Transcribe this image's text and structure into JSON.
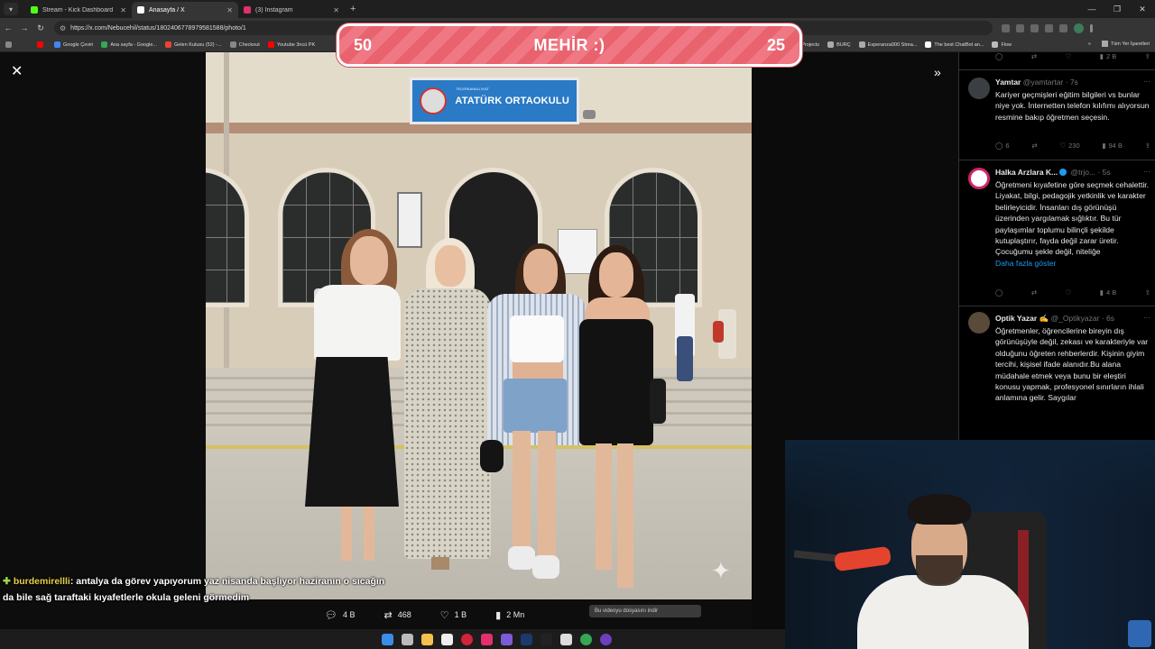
{
  "browser": {
    "tabs": [
      {
        "label": "Stream - Kick Dashboard",
        "active": false,
        "favicon_color": "#53fc18"
      },
      {
        "label": "Anasayfa / X",
        "active": true,
        "favicon_color": "#ffffff"
      },
      {
        "label": "(3) Instagram",
        "active": false,
        "favicon_color": "#e1306c"
      }
    ],
    "url": "https://x.com/Nebucehil/status/1802406778979581588/photo/1",
    "bookmarks": [
      {
        "label": "Google Çeviri",
        "color": "#4285f4"
      },
      {
        "label": "Ana sayfa - Google...",
        "color": "#34a853"
      },
      {
        "label": "Gelen Kutusu (52) -...",
        "color": "#ea4335"
      },
      {
        "label": "Checkout",
        "color": "#888888"
      },
      {
        "label": "Youtube 3ncü PK",
        "color": "#ff0000"
      },
      {
        "label": "yGen - Projects",
        "color": "#777777"
      },
      {
        "label": "BURÇ",
        "color": "#aaaaaa"
      },
      {
        "label": "Esperanza000 Strea...",
        "color": "#777777"
      },
      {
        "label": "The best ChatBot an...",
        "color": "#ffffff"
      },
      {
        "label": "Flow",
        "color": "#bbbbbb"
      }
    ],
    "bookmarks_all": "Tüm Yer İşaretleri"
  },
  "banner": {
    "left_number": "50",
    "title": "MEHİR :)",
    "right_number": "25"
  },
  "photo": {
    "sign_small": "TELERKANALI İKAT",
    "sign_name": "ATATÜRK ORTAOKULU"
  },
  "post_actions": {
    "replies": "4 B",
    "reposts": "468",
    "likes": "1 B",
    "views": "2 Mn",
    "download_hint": "Bu videoyu dosyasını indir"
  },
  "chat": {
    "username": "burdemirellli",
    "message": ": antalya da görev yapıyorum yaz nisanda başlıyor haziranın o sıcağın da bile sağ taraftaki kıyafetlerle okula geleni görmedim"
  },
  "tweets": [
    {
      "name": "",
      "handle": "",
      "time": "",
      "text": "",
      "replies": "",
      "reposts": "",
      "likes": "",
      "views": "2 B",
      "avatar_color": "#000000"
    },
    {
      "name": "Yamtar",
      "handle": "@yamtartar",
      "time": "· 7s",
      "text": "Kariyer geçmişleri eğitim bilgileri vs bunlar niye yok. İnternetten telefon kılıfımı alıyorsun resmine bakıp öğretmen seçesin.",
      "replies": "6",
      "reposts": "",
      "likes": "230",
      "views": "94 B",
      "avatar_color": "#3b3f44"
    },
    {
      "name": "Halka Arzlara K...",
      "handle": "@trjo...",
      "time": "· 5s",
      "text": "Öğretmeni kıyafetine göre seçmek cehalettir. Liyakat, bilgi, pedagojik yetkinlik ve karakter belirleyicidir. İnsanları dış görünüşü üzerinden yargılamak sığlıktır. Bu tür paylaşımlar toplumu bilinçli şekilde kutuplaştırır, fayda değil zarar üretir. Çocuğumu şekle değil, niteliğe",
      "show_more": "Daha fazla göster",
      "replies": "",
      "reposts": "",
      "likes": "",
      "views": "4 B",
      "avatar_color": "#d0246b"
    },
    {
      "name": "Optik Yazar ✍",
      "handle": "@_Optikyazar",
      "time": "· 6s",
      "text": "Öğretmenler, öğrencilerine bireyin dış görünüşüyle değil, zekası ve karakteriyle var olduğunu öğreten rehberlerdir. Kişinin giyim tercihi, kişisel ifade alanıdır.Bu alana müdahale etmek veya bunu bir eleştiri konusu yapmak, profesyonel sınırların ihlali anlamına gelir. Saygılar",
      "avatar_color": "#5a4a3a"
    }
  ],
  "icons": {
    "close": "close-icon",
    "expand": "double-chevron-right-icon",
    "reply": "reply-icon",
    "repost": "repost-icon",
    "like": "heart-icon",
    "views": "views-icon",
    "share": "share-icon"
  }
}
